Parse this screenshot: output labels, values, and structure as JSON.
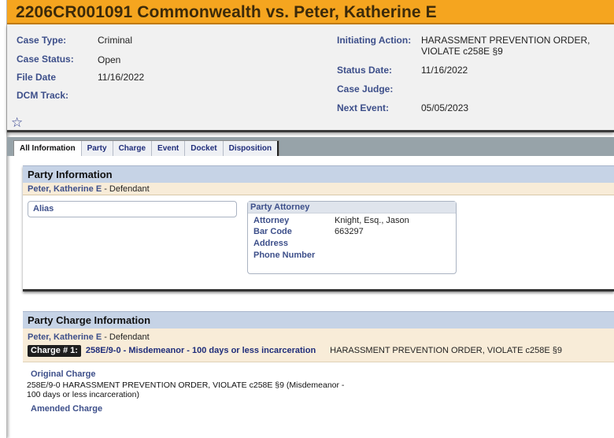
{
  "title": "2206CR001091 Commonwealth vs. Peter, Katherine E",
  "summary": {
    "case_type_label": "Case Type:",
    "case_type_value": "Criminal",
    "case_status_label": "Case Status:",
    "case_status_value": "Open",
    "file_date_label": "File Date",
    "file_date_value": "11/16/2022",
    "dcm_track_label": "DCM Track:",
    "initiating_action_label": "Initiating Action:",
    "initiating_action_value_line1": "HARASSMENT PREVENTION ORDER,",
    "initiating_action_value_line2": "VIOLATE c258E §9",
    "status_date_label": "Status Date:",
    "status_date_value": "11/16/2022",
    "case_judge_label": "Case Judge:",
    "next_event_label": "Next Event:",
    "next_event_value": "05/05/2023",
    "star_icon": "☆"
  },
  "tabs": [
    "All Information",
    "Party",
    "Charge",
    "Event",
    "Docket",
    "Disposition"
  ],
  "party_info": {
    "heading": "Party Information",
    "party_name": "Peter, Katherine E",
    "party_role": " - Defendant",
    "alias_label": "Alias",
    "attorney_box": {
      "heading": "Party Attorney",
      "attorney_label": "Attorney",
      "attorney_value": "Knight, Esq., Jason",
      "bar_code_label": "Bar Code",
      "bar_code_value": "663297",
      "address_label": "Address",
      "phone_label": "Phone Number"
    }
  },
  "charge_info": {
    "heading": "Party Charge Information",
    "party_name": "Peter, Katherine E",
    "party_role": " - Defendant",
    "charge_badge": "Charge # 1:",
    "charge_code": "258E/9-0 - Misdemeanor - 100 days or less incarceration",
    "charge_desc": "HARASSMENT PREVENTION ORDER, VIOLATE c258E §9",
    "original_label": "Original Charge",
    "original_text_line1": "258E/9-0 HARASSMENT PREVENTION ORDER, VIOLATE c258E §9 (Misdemeanor -",
    "original_text_line2": "100 days or less incarceration)",
    "amended_label": "Amended Charge"
  },
  "colors": {
    "title_bar": "#f5a51f",
    "label_blue": "#3d4f8a",
    "panel_header": "#c6d3e6",
    "party_strip": "#f8ecd8",
    "tab_bar": "#97a3a9"
  }
}
